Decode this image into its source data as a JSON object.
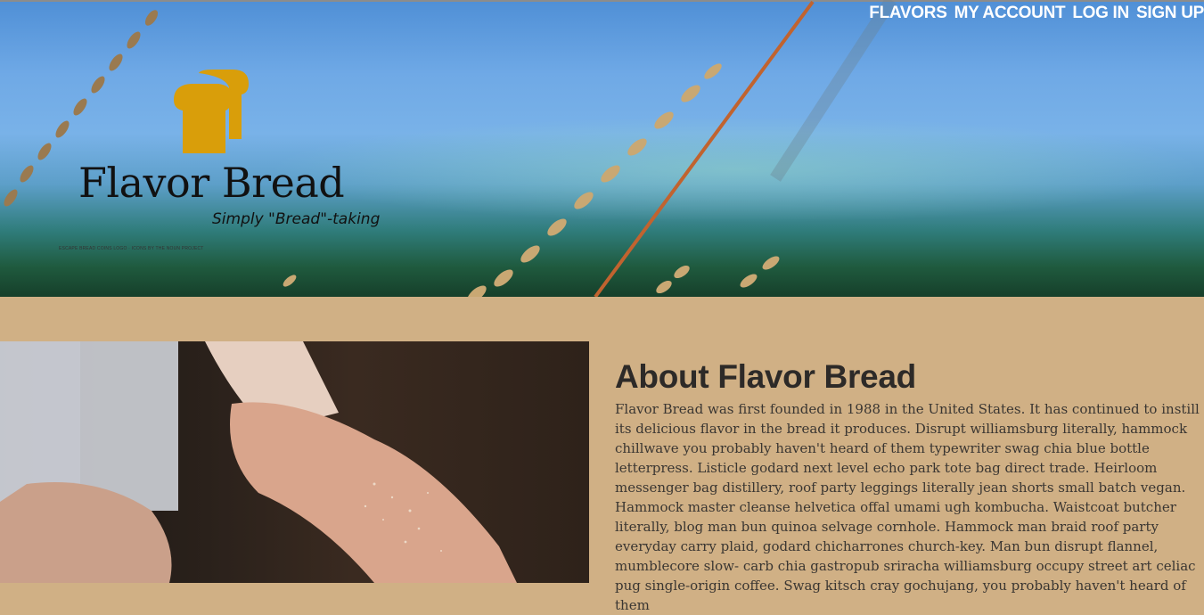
{
  "nav": {
    "items": [
      "FLAVORS",
      "MY ACCOUNT",
      "LOG IN",
      "SIGN UP"
    ]
  },
  "hero": {
    "brand": "Flavor Bread",
    "tagline": "Simply \"Bread\"-taking",
    "credit": "ESCAPE BREAD COINS LOGO · ICONS BY THE NOUN PROJECT",
    "icon": "bread-loaf-icon"
  },
  "about": {
    "title": "About Flavor Bread",
    "body": "Flavor Bread was first founded in 1988 in the United States. It has continued to instill its delicious flavor in the bread it produces. Disrupt williamsburg literally, hammock chillwave you probably haven't heard of them typewriter swag chia blue bottle letterpress. Listicle godard next level echo park tote bag direct trade. Heirloom messenger bag distillery, roof party leggings literally jean shorts small batch vegan. Hammock master cleanse helvetica offal umami ugh kombucha. Waistcoat butcher literally, blog man bun quinoa selvage cornhole. Hammock man braid roof party everyday carry plaid, godard chicharrones church-key. Man bun disrupt flannel, mumblecore slow- carb chia gastropub sriracha williamsburg occupy street art celiac pug single-origin coffee. Swag kitsch cray gochujang, you probably haven't heard of them"
  },
  "colors": {
    "page_bg": "#d0b085",
    "bread_icon": "#d99e0a"
  }
}
